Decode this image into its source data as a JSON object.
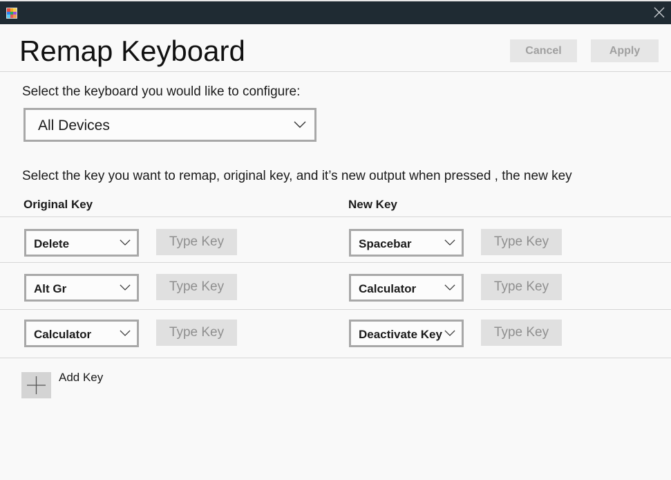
{
  "window": {
    "icon": "powertoys-app-icon",
    "close_icon": "close-icon"
  },
  "header": {
    "title": "Remap Keyboard",
    "cancel_label": "Cancel",
    "apply_label": "Apply"
  },
  "keyboard": {
    "prompt": "Select the keyboard you would like to configure:",
    "selected_device": "All Devices"
  },
  "remap": {
    "instructions": "Select the key you want to remap, original key, and it’s new output when pressed , the new key",
    "original_header": "Original Key",
    "new_header": "New Key",
    "type_key_label": "Type Key",
    "rows": [
      {
        "original": "Delete",
        "new": "Spacebar"
      },
      {
        "original": "Alt Gr",
        "new": "Calculator"
      },
      {
        "original": "Calculator",
        "new": "Deactivate Key"
      }
    ],
    "add_key_label": "Add Key"
  },
  "colors": {
    "titlebar": "#1f2b33",
    "button_disabled_bg": "#e6e6e6",
    "button_disabled_text": "#a0a0a0",
    "border": "#a8a8a8"
  }
}
